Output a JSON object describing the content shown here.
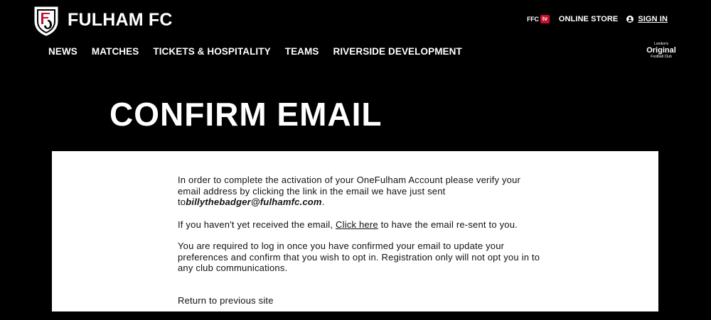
{
  "header": {
    "brand_name": "FULHAM FC",
    "utils": {
      "ffc": "FFC",
      "tv": "tv",
      "online_store": "ONLINE STORE",
      "sign_in": "SIGN IN"
    },
    "nav": [
      {
        "label": "NEWS"
      },
      {
        "label": "MATCHES"
      },
      {
        "label": "TICKETS & HOSPITALITY"
      },
      {
        "label": "TEAMS"
      },
      {
        "label": "RIVERSIDE DEVELOPMENT"
      }
    ],
    "tagline": {
      "top": "London's",
      "big": "Original",
      "bottom": "Football Club"
    }
  },
  "page": {
    "title": "CONFIRM EMAIL"
  },
  "message": {
    "para1_text": "In order to complete the activation of your OneFulham Account please verify your email address by clicking the link in the email we have just sent to",
    "email": "billythebadger@fulhamfc.com",
    "para1_end": ".",
    "para2_before": "If you haven't yet received the email, ",
    "para2_link": "Click here",
    "para2_after": " to have the email re-sent to you.",
    "para3": "You are required to log in once you have confirmed your email to update your preferences and confirm that you wish to opt in. Registration only will not opt you in to any club communications.",
    "return_link": "Return to previous site"
  },
  "colors": {
    "background": "#000000",
    "panel": "#ffffff",
    "tv_badge": "#c8102e",
    "text_dark": "#111111"
  }
}
